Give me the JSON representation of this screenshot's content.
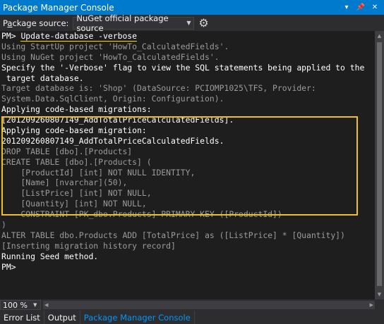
{
  "window": {
    "title": "Package Manager Console"
  },
  "toolbar": {
    "source_label_prefix": "P",
    "source_label_accel": "a",
    "source_label_rest": "ckage source:",
    "source_value": "NuGet official package source"
  },
  "console": {
    "lines": [
      {
        "prompt": "PM> ",
        "text": "Update-database -verbose",
        "style": "cmd"
      },
      {
        "text": "Using StartUp project 'HowTo_CalculatedFields'.",
        "style": "gray"
      },
      {
        "text": "Using NuGet project 'HowTo_CalculatedFields'.",
        "style": "gray"
      },
      {
        "text": "Specify the '-Verbose' flag to view the SQL statements being applied to the",
        "style": "white"
      },
      {
        "text": " target database.",
        "style": "white"
      },
      {
        "text": "Target database is: 'Shop' (DataSource: PCIOMP1025\\TFS, Provider:",
        "style": "gray"
      },
      {
        "text": "System.Data.SqlClient, Origin: Configuration).",
        "style": "gray"
      },
      {
        "text": "Applying code-based migrations:",
        "style": "white"
      },
      {
        "text": "[201209260807149_AddTotalPriceCalculatedFields].",
        "style": "white"
      },
      {
        "text": "Applying code-based migration:",
        "style": "white"
      },
      {
        "text": "201209260807149_AddTotalPriceCalculatedFields.",
        "style": "white"
      },
      {
        "text": "DROP TABLE [dbo].[Products]",
        "style": "gray"
      },
      {
        "text": "CREATE TABLE [dbo].[Products] (",
        "style": "gray"
      },
      {
        "text": "    [ProductId] [int] NOT NULL IDENTITY,",
        "style": "gray"
      },
      {
        "text": "    [Name] [nvarchar](50),",
        "style": "gray"
      },
      {
        "text": "    [ListPrice] [int] NOT NULL,",
        "style": "gray"
      },
      {
        "text": "    [Quantity] [int] NOT NULL,",
        "style": "gray"
      },
      {
        "text": "    CONSTRAINT [PK_dbo.Products] PRIMARY KEY ([ProductId])",
        "style": "gray"
      },
      {
        "text": ")",
        "style": "gray"
      },
      {
        "text": "ALTER TABLE dbo.Products ADD [TotalPrice] as ([ListPrice] * [Quantity])",
        "style": "gray"
      },
      {
        "text": "[Inserting migration history record]",
        "style": "gray"
      },
      {
        "text": "Running Seed method.",
        "style": "white"
      },
      {
        "text": "PM>",
        "style": "white"
      }
    ]
  },
  "zoom": {
    "value": "100 %"
  },
  "tabs": [
    {
      "label": "Error List",
      "active": false
    },
    {
      "label": "Output",
      "active": false
    },
    {
      "label": "Package Manager Console",
      "active": true
    }
  ],
  "colors": {
    "accent": "#007acc",
    "highlight_border": "#f0c020",
    "active_tab": "#0097fb"
  }
}
